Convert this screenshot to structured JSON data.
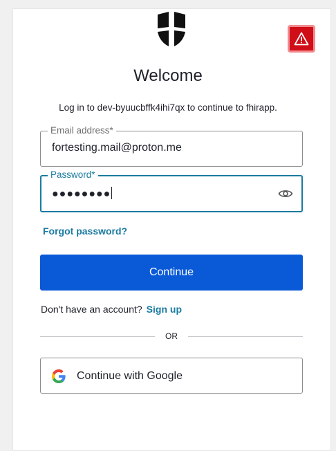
{
  "header": {
    "title": "Welcome",
    "subtitle": "Log in to dev-byuucbffk4ihi7qx to continue to fhirapp."
  },
  "form": {
    "email": {
      "label": "Email address*",
      "value": "fortesting.mail@proton.me"
    },
    "password": {
      "label": "Password*",
      "masked_value": "●●●●●●●●"
    },
    "forgot_password": "Forgot password?",
    "continue_label": "Continue"
  },
  "signup": {
    "prompt": "Don't have an account?",
    "link": "Sign up"
  },
  "divider": {
    "text": "OR"
  },
  "social": {
    "google_label": "Continue with Google"
  },
  "colors": {
    "primary": "#0a5ad8",
    "link": "#1a7ba1",
    "warning": "#d00e17"
  },
  "icons": [
    "shield-logo-icon",
    "warning-icon",
    "eye-icon",
    "google-icon"
  ]
}
